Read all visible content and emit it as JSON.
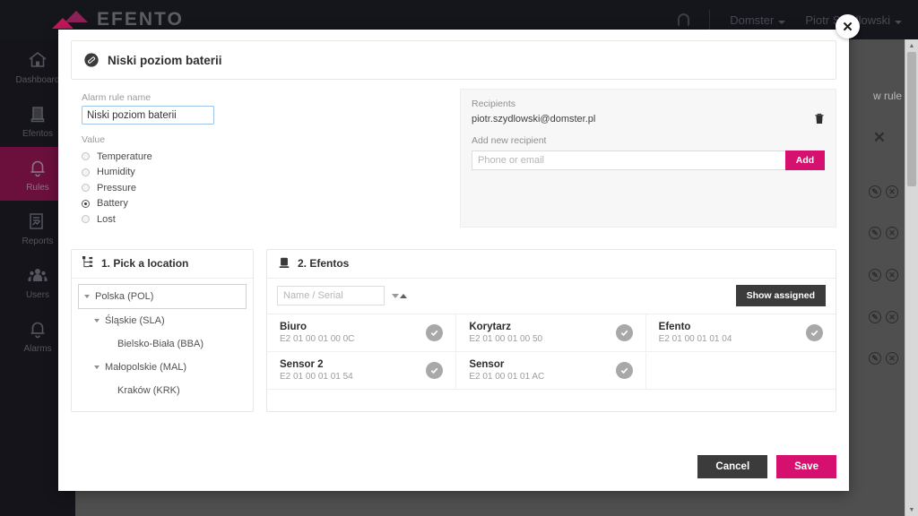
{
  "background": {
    "logo_text": "EFENTO",
    "account_menu": "Domster",
    "user_menu": "Piotr Szydlowski",
    "new_rule_label": "w rule",
    "close_label": "✕",
    "row_count": 5,
    "edit_icon_label": "✎",
    "delete_icon_label": "✕"
  },
  "sidebar": {
    "items": [
      {
        "label": "Dashboard",
        "icon": "home-icon",
        "active": false
      },
      {
        "label": "Efentos",
        "icon": "device-icon",
        "active": false
      },
      {
        "label": "Rules",
        "icon": "bell-icon",
        "active": true
      },
      {
        "label": "Reports",
        "icon": "report-icon",
        "active": false
      },
      {
        "label": "Users",
        "icon": "users-icon",
        "active": false
      },
      {
        "label": "Alarms",
        "icon": "bell-icon",
        "active": false
      }
    ]
  },
  "modal": {
    "title": "Niski poziom baterii",
    "title_icon": "battery-icon",
    "close_label": "✕",
    "form": {
      "name_label": "Alarm rule name",
      "name_value": "Niski poziom baterii",
      "value_label": "Value",
      "value_options": [
        {
          "label": "Temperature",
          "selected": false
        },
        {
          "label": "Humidity",
          "selected": false
        },
        {
          "label": "Pressure",
          "selected": false
        },
        {
          "label": "Battery",
          "selected": true
        },
        {
          "label": "Lost",
          "selected": false
        }
      ]
    },
    "recipients": {
      "title": "Recipients",
      "list": [
        "piotr.szydlowski@domster.pl"
      ],
      "delete_icon": "trash-icon",
      "add_label": "Add new recipient",
      "input_placeholder": "Phone or email",
      "input_value": "",
      "add_button": "Add"
    },
    "location_panel": {
      "title": "1. Pick a location",
      "icon": "sitemap-icon",
      "tree": [
        {
          "label": "Polska (POL)",
          "depth": 0,
          "expandable": true,
          "selected": true
        },
        {
          "label": "Śląskie (SLA)",
          "depth": 1,
          "expandable": true,
          "selected": false
        },
        {
          "label": "Bielsko-Biała (BBA)",
          "depth": 2,
          "expandable": false,
          "selected": false
        },
        {
          "label": "Małopolskie (MAL)",
          "depth": 1,
          "expandable": true,
          "selected": false
        },
        {
          "label": "Kraków (KRK)",
          "depth": 2,
          "expandable": false,
          "selected": false
        }
      ]
    },
    "efentos_panel": {
      "title": "2. Efentos",
      "icon": "device-icon",
      "search_placeholder": "Name / Serial",
      "search_value": "",
      "sort_icon": "sort-arrows-icon",
      "show_assigned_button": "Show assigned",
      "devices": [
        {
          "name": "Biuro",
          "serial": "E2 01 00 01 00 0C",
          "selected": true
        },
        {
          "name": "Korytarz",
          "serial": "E2 01 00 01 00 50",
          "selected": true
        },
        {
          "name": "Efento",
          "serial": "E2 01 00 01 01 04",
          "selected": true
        },
        {
          "name": "Sensor 2",
          "serial": "E2 01 00 01 01 54",
          "selected": true
        },
        {
          "name": "Sensor",
          "serial": "E2 01 00 01 01 AC",
          "selected": true
        }
      ]
    },
    "footer": {
      "cancel": "Cancel",
      "save": "Save"
    }
  },
  "colors": {
    "accent": "#d6106f",
    "active_nav": "#6b0f3d",
    "dark": "#3b3b3b"
  }
}
